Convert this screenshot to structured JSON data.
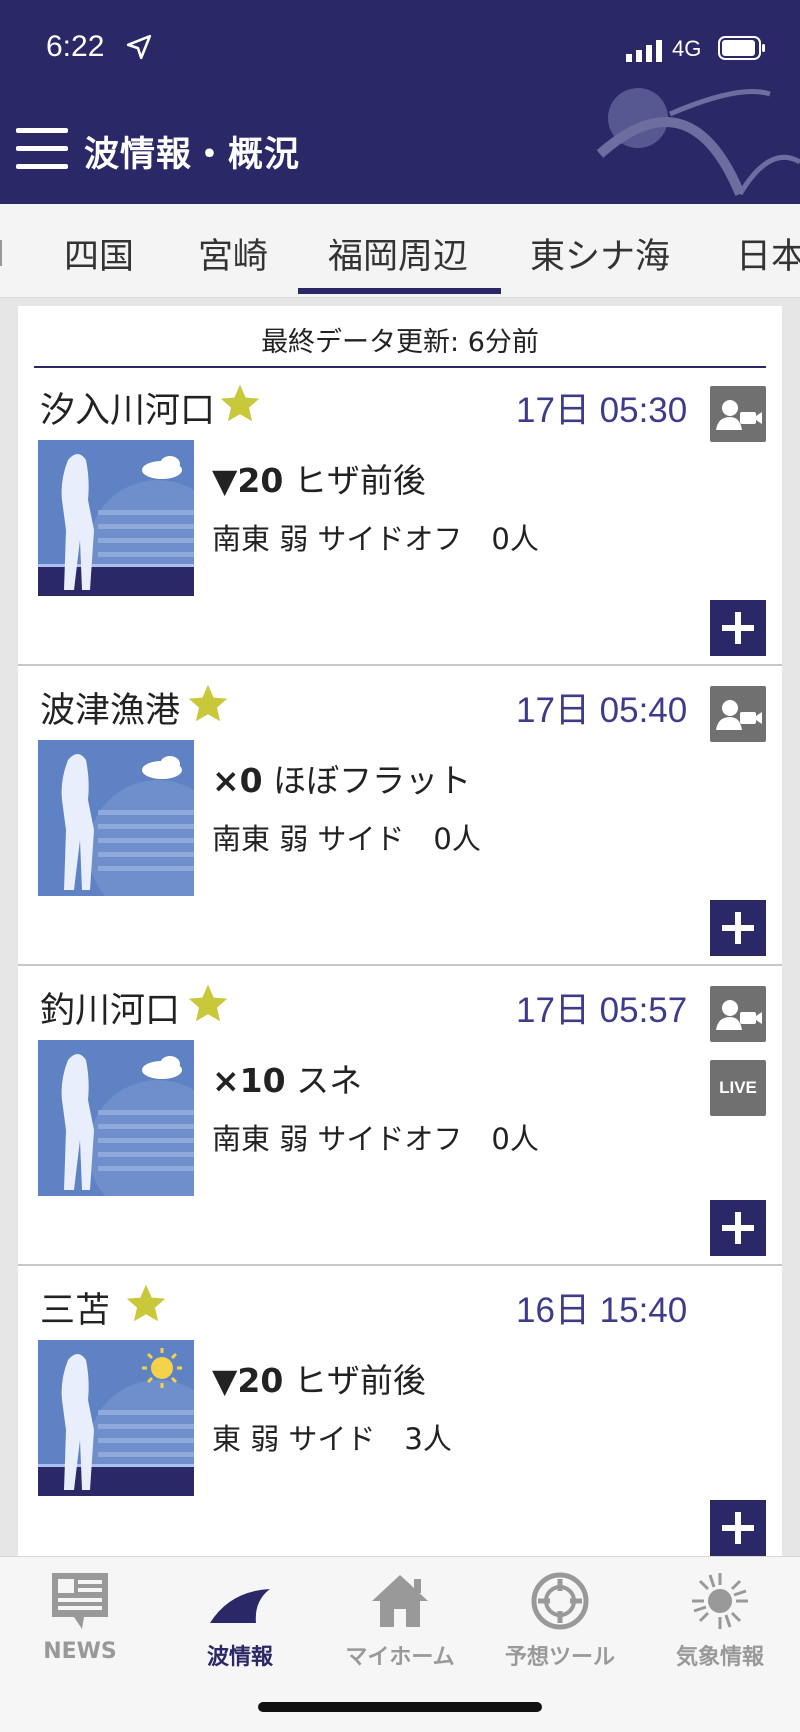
{
  "statusbar": {
    "time": "6:22",
    "network": "4G"
  },
  "header": {
    "title": "波情報・概況"
  },
  "tabs": [
    {
      "label": "四国"
    },
    {
      "label": "宮崎"
    },
    {
      "label": "福岡周辺",
      "active": true
    },
    {
      "label": "東シナ海"
    },
    {
      "label": "日本"
    }
  ],
  "updated": "最終データ更新: 6分前",
  "spots": [
    {
      "name": "汐入川河口",
      "time": "17日 05:30",
      "wave_size": "▼20",
      "wave_text": "ヒザ前後",
      "wind": "南東 弱 サイドオフ　0人",
      "weather": "cloud",
      "camera": true,
      "live": false
    },
    {
      "name": "波津漁港",
      "time": "17日 05:40",
      "wave_size": "×0",
      "wave_text": "ほぼフラット",
      "wind": "南東 弱 サイド　0人",
      "weather": "cloud",
      "camera": true,
      "live": false
    },
    {
      "name": "釣川河口",
      "time": "17日 05:57",
      "wave_size": "×10",
      "wave_text": "スネ",
      "wind": "南東 弱 サイドオフ　0人",
      "weather": "cloud",
      "camera": true,
      "live": true,
      "live_label": "LIVE"
    },
    {
      "name": "三苫",
      "time": "16日 15:40",
      "wave_size": "▼20",
      "wave_text": "ヒザ前後",
      "wind": "東 弱 サイド　3人",
      "weather": "sun",
      "camera": false,
      "live": false
    }
  ],
  "bottom_nav": [
    {
      "label": "NEWS",
      "icon": "news-icon"
    },
    {
      "label": "波情報",
      "icon": "wave-icon",
      "active": true
    },
    {
      "label": "マイホーム",
      "icon": "home-icon"
    },
    {
      "label": "予想ツール",
      "icon": "target-icon"
    },
    {
      "label": "気象情報",
      "icon": "sun-icon"
    }
  ],
  "colors": {
    "primary": "#2a2867",
    "star": "#c8c83a",
    "time": "#3d3b8a",
    "thumb_bg": "#5f82c4"
  }
}
